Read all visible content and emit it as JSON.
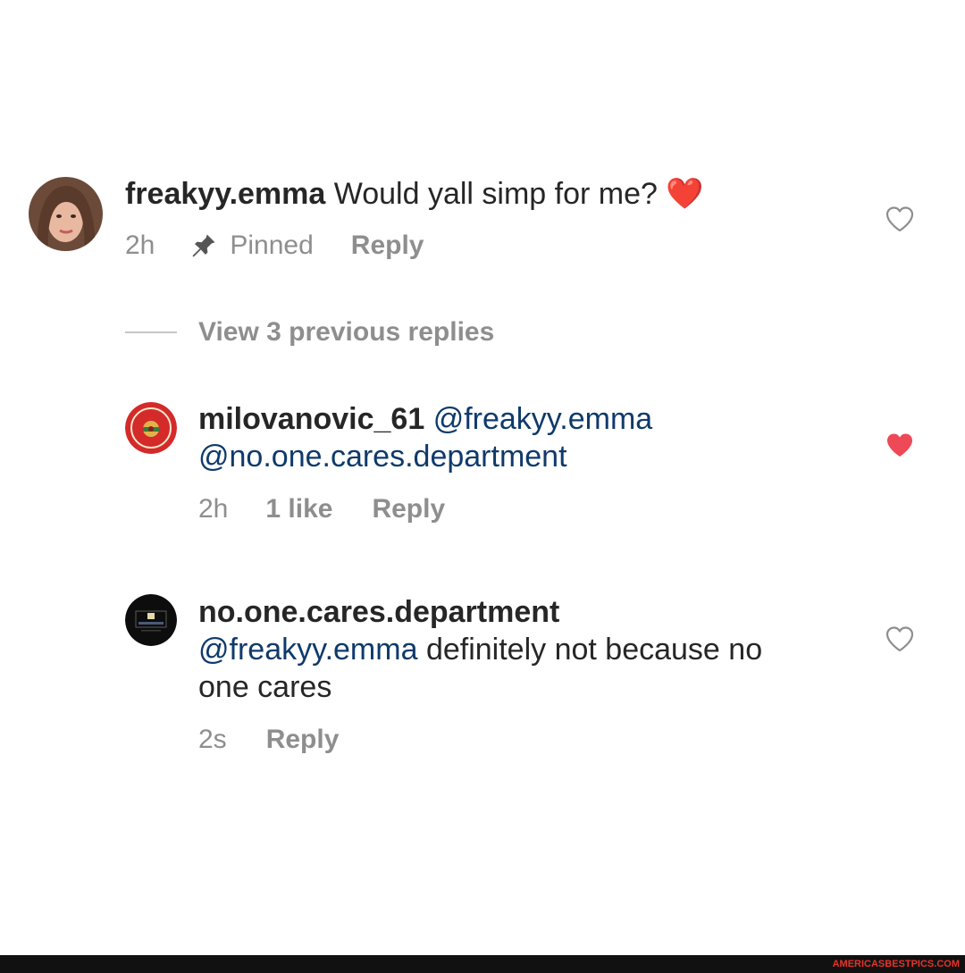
{
  "comments": [
    {
      "username": "freakyy.emma",
      "text": "Would yall simp for me?",
      "emoji": "❤️",
      "time": "2h",
      "pinned_label": "Pinned",
      "reply_label": "Reply",
      "liked": false
    },
    {
      "username": "milovanovic_61",
      "mention1": "@freakyy.emma",
      "mention2": "@no.one.cares.department",
      "time": "2h",
      "likes_label": "1 like",
      "reply_label": "Reply",
      "liked": true
    },
    {
      "username": "no.one.cares.department",
      "mention": "@freakyy.emma",
      "text_line1": " definitely not because no",
      "text_line2": "one cares",
      "time": "2s",
      "reply_label": "Reply",
      "liked": false
    }
  ],
  "view_replies_label": "View 3 previous replies",
  "watermark": "AMERICASBESTPICS.COM",
  "colors": {
    "liked_heart": "#ed4956",
    "mention": "#0f3a6b",
    "meta_gray": "#8e8e8e"
  }
}
